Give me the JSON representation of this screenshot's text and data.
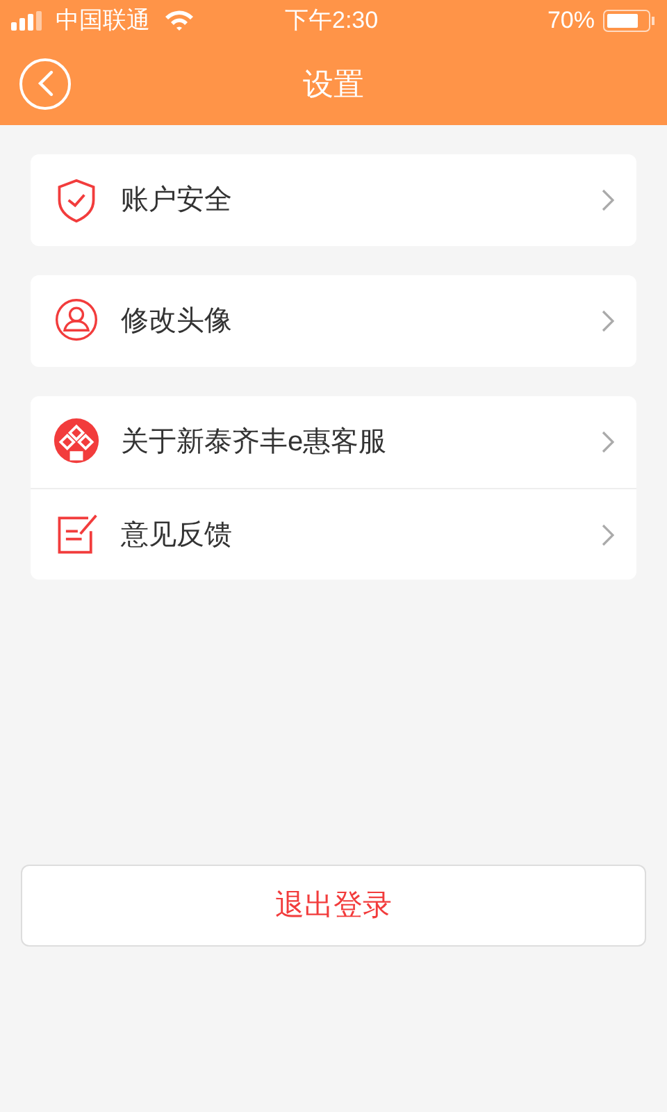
{
  "status_bar": {
    "carrier": "中国联通",
    "time": "下午2:30",
    "battery": "70%"
  },
  "header": {
    "title": "设置"
  },
  "groups": [
    {
      "items": [
        {
          "kind": "shield",
          "label": "账户安全"
        }
      ]
    },
    {
      "items": [
        {
          "kind": "person",
          "label": "修改头像"
        }
      ]
    },
    {
      "items": [
        {
          "kind": "logo",
          "label": "关于新泰齐丰e惠客服"
        },
        {
          "kind": "feedback",
          "label": "意见反馈"
        }
      ]
    }
  ],
  "logout_button": "退出登录"
}
